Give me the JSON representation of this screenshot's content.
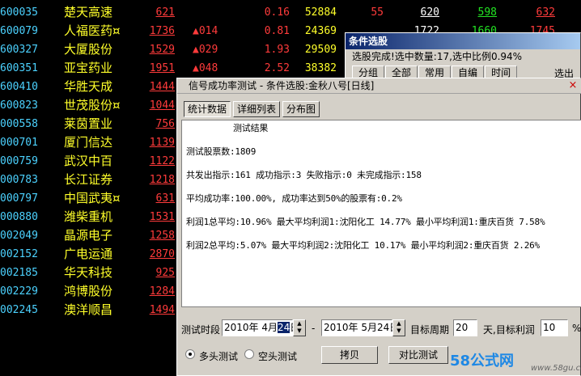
{
  "stocks": [
    {
      "code": "600035",
      "name": "楚天高速",
      "price": "621",
      "change": "",
      "pct": "0.16",
      "vol": "52884",
      "x1": "55",
      "x2": "620",
      "x3": "598",
      "x4": "632"
    },
    {
      "code": "600079",
      "name": "人福医药¤",
      "price": "1736",
      "change": "▲014",
      "pct": "0.81",
      "vol": "24369",
      "x1": "",
      "x2": "",
      "x3": "",
      "x4": ""
    },
    {
      "code": "600327",
      "name": "大厦股份",
      "price": "1529",
      "change": "▲029",
      "pct": "1.93",
      "vol": "29509",
      "x1": "",
      "x2": "",
      "x3": "",
      "x4": ""
    },
    {
      "code": "600351",
      "name": "亚宝药业",
      "price": "1951",
      "change": "▲048",
      "pct": "2.52",
      "vol": "38382",
      "x1": "",
      "x2": "",
      "x3": "",
      "x4": ""
    },
    {
      "code": "600410",
      "name": "华胜天成",
      "price": "1444",
      "change": "",
      "pct": "",
      "vol": "",
      "x1": "",
      "x2": "",
      "x3": "",
      "x4": ""
    },
    {
      "code": "600823",
      "name": "世茂股份¤",
      "price": "1044",
      "change": "",
      "pct": "",
      "vol": "",
      "x1": "",
      "x2": "",
      "x3": "",
      "x4": ""
    },
    {
      "code": "000558",
      "name": "莱茵置业",
      "price": "756",
      "change": "",
      "pct": "",
      "vol": "",
      "x1": "",
      "x2": "",
      "x3": "",
      "x4": ""
    },
    {
      "code": "000701",
      "name": "厦门信达",
      "price": "1139",
      "change": "",
      "pct": "",
      "vol": "",
      "x1": "",
      "x2": "",
      "x3": "",
      "x4": ""
    },
    {
      "code": "000759",
      "name": "武汉中百",
      "price": "1122",
      "change": "",
      "pct": "",
      "vol": "",
      "x1": "",
      "x2": "",
      "x3": "",
      "x4": ""
    },
    {
      "code": "000783",
      "name": "长江证券",
      "price": "1218",
      "change": "",
      "pct": "",
      "vol": "",
      "x1": "",
      "x2": "",
      "x3": "",
      "x4": ""
    },
    {
      "code": "000797",
      "name": "中国武夷¤",
      "price": "631",
      "change": "",
      "pct": "",
      "vol": "",
      "x1": "",
      "x2": "",
      "x3": "",
      "x4": ""
    },
    {
      "code": "000880",
      "name": "潍柴重机",
      "price": "1531",
      "change": "",
      "pct": "",
      "vol": "",
      "x1": "",
      "x2": "",
      "x3": "",
      "x4": ""
    },
    {
      "code": "002049",
      "name": "晶源电子",
      "price": "1258",
      "change": "",
      "pct": "",
      "vol": "",
      "x1": "",
      "x2": "",
      "x3": "",
      "x4": ""
    },
    {
      "code": "002152",
      "name": "广电运通",
      "price": "2870",
      "change": "",
      "pct": "",
      "vol": "",
      "x1": "",
      "x2": "",
      "x3": "",
      "x4": ""
    },
    {
      "code": "002185",
      "name": "华天科技",
      "price": "925",
      "change": "",
      "pct": "",
      "vol": "",
      "x1": "",
      "x2": "",
      "x3": "",
      "x4": ""
    },
    {
      "code": "002229",
      "name": "鸿博股份",
      "price": "1284",
      "change": "",
      "pct": "",
      "vol": "",
      "x1": "",
      "x2": "",
      "x3": "",
      "x4": ""
    },
    {
      "code": "002245",
      "name": "澳洋顺昌",
      "price": "1494",
      "change": "",
      "pct": "",
      "vol": "",
      "x1": "",
      "x2": "",
      "x3": "",
      "x4": ""
    }
  ],
  "row2_partial": {
    "x2": "1722",
    "x3": "1660",
    "x4": "1745"
  },
  "cond_window": {
    "title": "条件选股",
    "status": "选股完成!选中数量:17,选中比例0.94%",
    "tabs": [
      "分组",
      "全部",
      "常用",
      "自编",
      "时间"
    ],
    "right_label": "选出"
  },
  "dialog": {
    "title": "信号成功率测试 - 条件选股:金秋八号[日线]",
    "close_label": "×",
    "tabs": [
      "统计数据",
      "详细列表",
      "分布图"
    ],
    "result": {
      "heading": "测试结果",
      "total_stocks": "测试股票数:1809",
      "signals": "共发出指示:161 成功指示:3 失败指示:0 未完成指示:158",
      "success_rate": "平均成功率:100.00%, 成功率达到50%的股票有:0.2%",
      "profit1": "利润1总平均:10.96% 最大平均利润1:沈阳化工 14.77% 最小平均利润1:重庆百货 7.58%",
      "profit2": "利润2总平均:5.07% 最大平均利润2:沈阳化工 10.17% 最小平均利润2:重庆百货 2.26%"
    },
    "controls": {
      "period_label": "测试时段",
      "date_from_a": "2010年 4月",
      "date_from_sel": "24",
      "date_from_b": "日",
      "dash": "-",
      "date_to": "2010年 5月24日",
      "target_period_label": "目标周期",
      "target_period_value": "20",
      "target_profit_label": "天,目标利润",
      "target_profit_value": "10",
      "pct_sign": "%",
      "radio_long": "多头测试",
      "radio_short": "空头测试",
      "copy_button": "拷贝",
      "compare_button": "对比测试"
    }
  },
  "watermark": {
    "text": "58公式网",
    "url": "www.58gu.com"
  },
  "colors": {
    "code": "#4cd2ff",
    "name": "#ffff2a",
    "up": "#ff3b3b",
    "down": "#22e422",
    "dialog_bg": "#d4d0c8",
    "watermark": "#1e88e5"
  }
}
